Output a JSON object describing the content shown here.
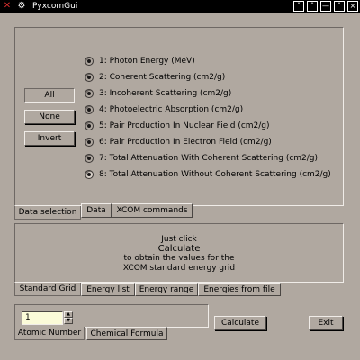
{
  "titlebar": {
    "title": "PyxcomGui",
    "buttons": [
      "ˇ",
      "ˆ",
      "—",
      "˄",
      "×"
    ]
  },
  "data_selection": {
    "buttons": {
      "all": "All",
      "none": "None",
      "invert": "Invert"
    },
    "options": [
      "1: Photon Energy (MeV)",
      "2: Coherent Scattering (cm2/g)",
      "3: Incoherent Scattering (cm2/g)",
      "4: Photoelectric Absorption (cm2/g)",
      "5: Pair Production In Nuclear Field (cm2/g)",
      "6: Pair Production In Electron Field (cm2/g)",
      "7: Total Attenuation With Coherent Scattering (cm2/g)",
      "8: Total Attenuation Without Coherent Scattering (cm2/g)"
    ],
    "selected_index": 7,
    "tabs": [
      "Data selection",
      "Data",
      "XCOM commands"
    ]
  },
  "grid": {
    "line1": "Just click",
    "line2": "Calculate",
    "line3": "to obtain the values for the",
    "line4": "XCOM standard energy grid",
    "tabs": [
      "Standard Grid",
      "Energy list",
      "Energy range",
      "Energies from file"
    ]
  },
  "bottom": {
    "atomic_number_value": "1",
    "tabs": [
      "Atomic Number",
      "Chemical Formula"
    ],
    "calculate_label": "Calculate",
    "exit_label": "Exit"
  },
  "colors": {
    "background": "#b0a8a0",
    "titlebar": "#000000",
    "input_bg": "#fbfbd8",
    "close_x": "#e03030"
  }
}
